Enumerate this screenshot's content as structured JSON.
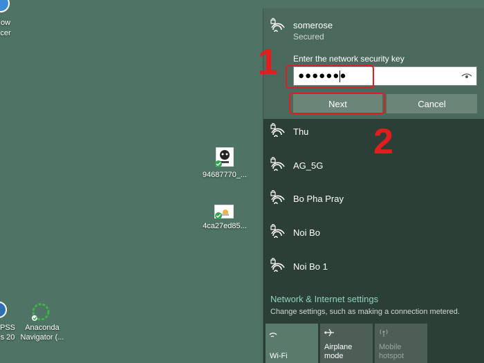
{
  "desktop": {
    "top_left_text": [
      "ow",
      "cer"
    ],
    "icon_1_label": "94687770_...",
    "icon_2_label": "4ca27ed85...",
    "bottom_left_1": [
      "PSS",
      "s 20"
    ],
    "bottom_left_2": [
      "Anaconda",
      "Navigator (..."
    ]
  },
  "selected_network": {
    "name": "somerose",
    "status": "Secured",
    "key_label": "Enter the network security key",
    "key_value": "●●●●●●●",
    "next_label": "Next",
    "cancel_label": "Cancel"
  },
  "networks": [
    {
      "name": "Thu"
    },
    {
      "name": "AG_5G"
    },
    {
      "name": "Bo Pha Pray"
    },
    {
      "name": "Noi Bo"
    },
    {
      "name": "Noi Bo 1"
    }
  ],
  "settings": {
    "link": "Network & Internet settings",
    "description": "Change settings, such as making a connection metered."
  },
  "quick_actions": [
    {
      "label": "Wi-Fi",
      "icon": "wifi-icon",
      "active": true
    },
    {
      "label": "Airplane mode",
      "icon": "airplane-icon",
      "active": false
    },
    {
      "label": "Mobile hotspot",
      "icon": "hotspot-icon",
      "active": false,
      "disabled": true
    }
  ],
  "annotations": {
    "step1": "1",
    "step2": "2"
  },
  "colors": {
    "annotation": "#e11d1d",
    "link": "#8fd3c0",
    "selected_bg": "#4b6a5d"
  }
}
